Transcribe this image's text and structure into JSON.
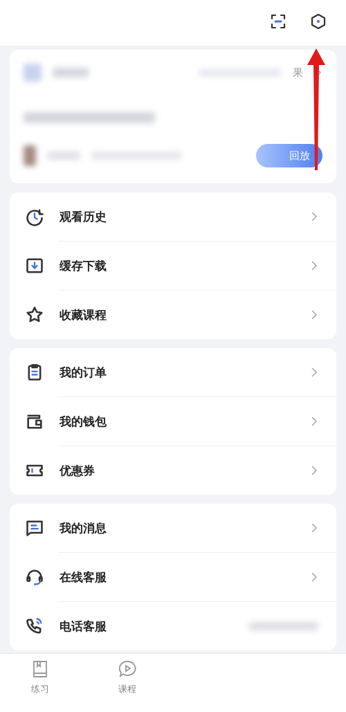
{
  "live_card": {
    "more_label": "果",
    "button_label": "回放"
  },
  "sections": [
    {
      "items": [
        {
          "label": "观看历史",
          "kind": "link"
        },
        {
          "label": "缓存下载",
          "kind": "link"
        },
        {
          "label": "收藏课程",
          "kind": "link"
        }
      ]
    },
    {
      "items": [
        {
          "label": "我的订单",
          "kind": "link"
        },
        {
          "label": "我的钱包",
          "kind": "link"
        },
        {
          "label": "优惠券",
          "kind": "link"
        }
      ]
    },
    {
      "items": [
        {
          "label": "我的消息",
          "kind": "link"
        },
        {
          "label": "在线客服",
          "kind": "link"
        },
        {
          "label": "电话客服",
          "kind": "phone"
        }
      ]
    }
  ],
  "tab_bar": [
    {
      "label": "练习",
      "selected": false
    },
    {
      "label": "课程",
      "selected": false
    }
  ]
}
